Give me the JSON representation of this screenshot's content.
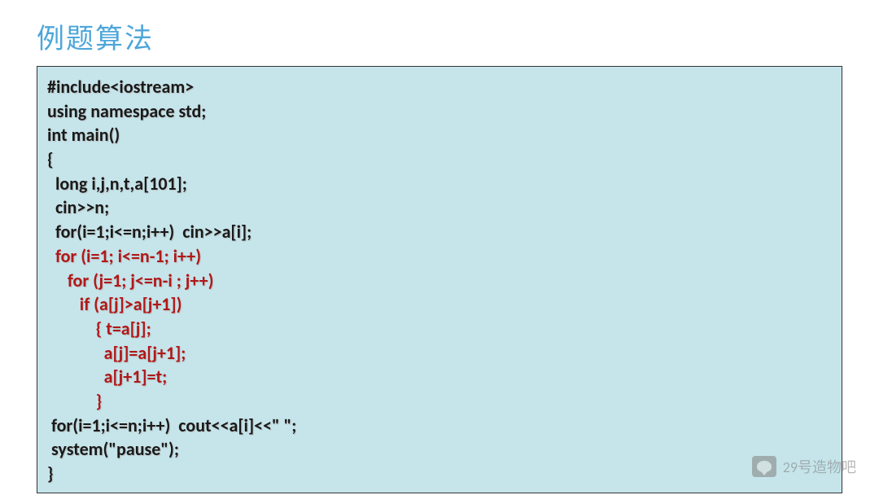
{
  "title": "例题算法",
  "code": {
    "line1": "#include<iostream>",
    "line2": "using namespace std;",
    "line3": "int main()",
    "line4": "{",
    "line5": "  long i,j,n,t,a[101];",
    "line6": "  cin>>n;",
    "line7": "  for(i=1;i<=n;i++)  cin>>a[i];",
    "line8": "  for (i=1; i<=n-1; i++)",
    "line9": "     for (j=1; j<=n-i ; j++)",
    "line10": "        if (a[j]>a[j+1])",
    "line11": "            { t=a[j];",
    "line12": "              a[j]=a[j+1];",
    "line13": "              a[j+1]=t;",
    "line14": "            }",
    "line15": " for(i=1;i<=n;i++)  cout<<a[i]<<\" \";",
    "line16": " system(\"pause\");",
    "line17": "}"
  },
  "watermark": {
    "text": "29号造物吧"
  }
}
